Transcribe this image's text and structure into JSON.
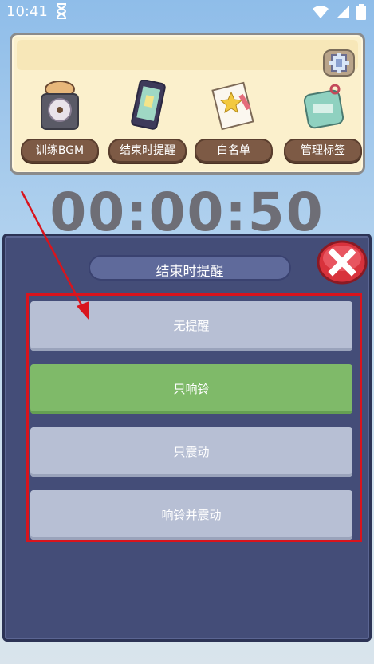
{
  "status_bar": {
    "time": "10:41"
  },
  "toolbar": {
    "features": [
      {
        "label": "训练BGM"
      },
      {
        "label": "结束时提醒"
      },
      {
        "label": "白名单"
      },
      {
        "label": "管理标签"
      }
    ]
  },
  "timer": {
    "value": "00:00:50"
  },
  "dialog": {
    "title": "结束时提醒",
    "options": [
      {
        "label": "无提醒",
        "selected": false
      },
      {
        "label": "只响铃",
        "selected": true
      },
      {
        "label": "只震动",
        "selected": false
      },
      {
        "label": "响铃并震动",
        "selected": false
      }
    ]
  },
  "colors": {
    "selected_option": "#7fba69",
    "option": "#b7bfd4",
    "dialog_bg": "#444d78",
    "annotation": "#d9141d"
  }
}
